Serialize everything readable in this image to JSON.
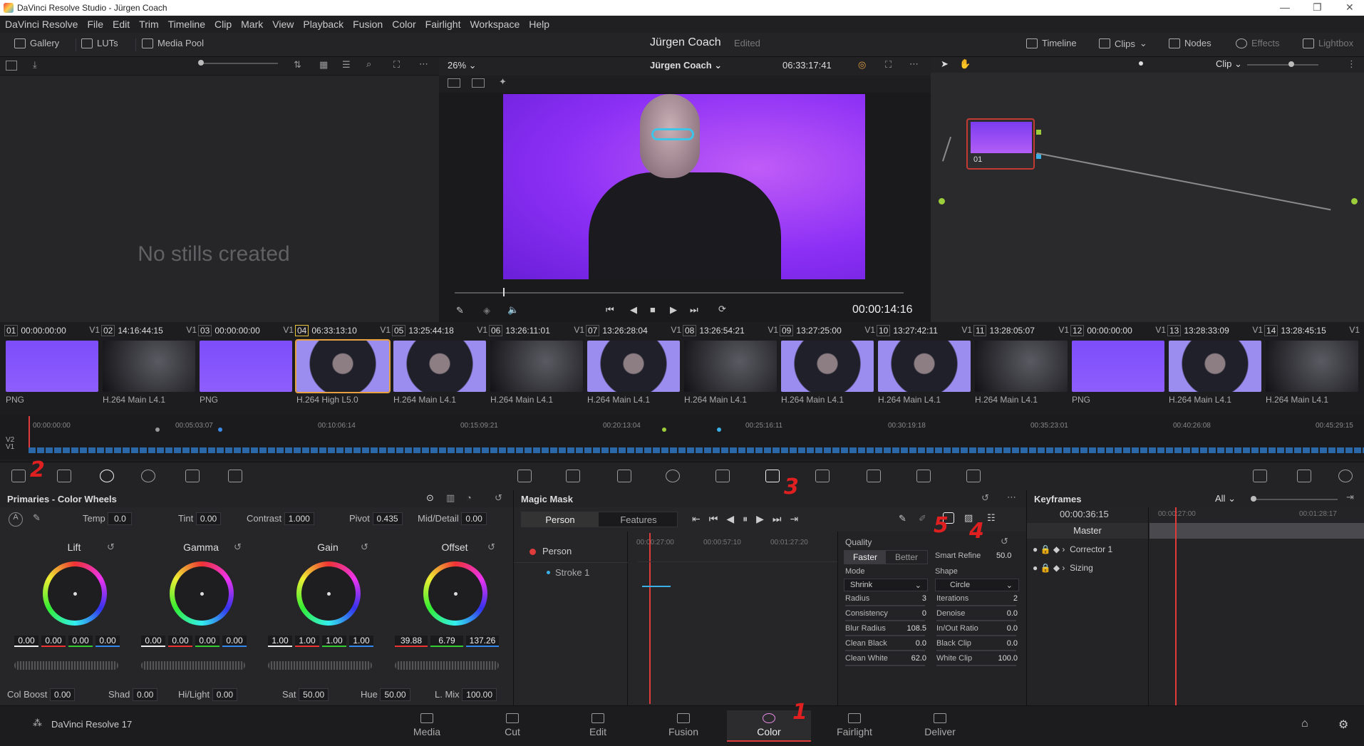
{
  "window": {
    "title": "DaVinci Resolve Studio - Jürgen Coach"
  },
  "menu": [
    "DaVinci Resolve",
    "File",
    "Edit",
    "Trim",
    "Timeline",
    "Clip",
    "Mark",
    "View",
    "Playback",
    "Fusion",
    "Color",
    "Fairlight",
    "Workspace",
    "Help"
  ],
  "toolbar": {
    "gallery": "Gallery",
    "luts": "LUTs",
    "media_pool": "Media Pool",
    "project": "Jürgen Coach",
    "status": "Edited",
    "timeline": "Timeline",
    "clips": "Clips",
    "nodes": "Nodes",
    "effects": "Effects",
    "lightbox": "Lightbox"
  },
  "gallery": {
    "empty": "No stills created"
  },
  "viewer": {
    "zoom": "26%",
    "timeline_name": "Jürgen Coach",
    "timecode_top": "06:33:17:41",
    "timecode": "00:00:14:16"
  },
  "nodes": {
    "mode": "Clip",
    "node_label": "01"
  },
  "clips": [
    {
      "num": "01",
      "tc": "00:00:00:00",
      "track": "V1",
      "codec": "PNG",
      "kind": "png"
    },
    {
      "num": "02",
      "tc": "14:16:44:15",
      "track": "V1",
      "codec": "H.264 Main L4.1",
      "kind": "dark"
    },
    {
      "num": "03",
      "tc": "00:00:00:00",
      "track": "V1",
      "codec": "PNG",
      "kind": "png"
    },
    {
      "num": "04",
      "tc": "06:33:13:10",
      "track": "V1",
      "codec": "H.264 High L5.0",
      "kind": "face"
    },
    {
      "num": "05",
      "tc": "13:25:44:18",
      "track": "V1",
      "codec": "H.264 Main L4.1",
      "kind": "face"
    },
    {
      "num": "06",
      "tc": "13:26:11:01",
      "track": "V1",
      "codec": "H.264 Main L4.1",
      "kind": "dark"
    },
    {
      "num": "07",
      "tc": "13:26:28:04",
      "track": "V1",
      "codec": "H.264 Main L4.1",
      "kind": "face"
    },
    {
      "num": "08",
      "tc": "13:26:54:21",
      "track": "V1",
      "codec": "H.264 Main L4.1",
      "kind": "dark"
    },
    {
      "num": "09",
      "tc": "13:27:25:00",
      "track": "V1",
      "codec": "H.264 Main L4.1",
      "kind": "face"
    },
    {
      "num": "10",
      "tc": "13:27:42:11",
      "track": "V1",
      "codec": "H.264 Main L4.1",
      "kind": "face"
    },
    {
      "num": "11",
      "tc": "13:28:05:07",
      "track": "V1",
      "codec": "H.264 Main L4.1",
      "kind": "dark"
    },
    {
      "num": "12",
      "tc": "00:00:00:00",
      "track": "V1",
      "codec": "PNG",
      "kind": "png"
    },
    {
      "num": "13",
      "tc": "13:28:33:09",
      "track": "V1",
      "codec": "H.264 Main L4.1",
      "kind": "face"
    },
    {
      "num": "14",
      "tc": "13:28:45:15",
      "track": "V1",
      "codec": "H.264 Main L4.1",
      "kind": "dark"
    }
  ],
  "ruler": [
    "00:00:00:00",
    "00:05:03:07",
    "00:10:06:14",
    "00:15:09:21",
    "00:20:13:04",
    "00:25:16:11",
    "00:30:19:18",
    "00:35:23:01",
    "00:40:26:08",
    "00:45:29:15"
  ],
  "tracks": {
    "v2": "V2",
    "v1": "V1"
  },
  "primaries": {
    "title": "Primaries - Color Wheels",
    "temp_label": "Temp",
    "temp": "0.0",
    "tint_label": "Tint",
    "tint": "0.00",
    "contrast_label": "Contrast",
    "contrast": "1.000",
    "pivot_label": "Pivot",
    "pivot": "0.435",
    "md_label": "Mid/Detail",
    "md": "0.00",
    "wheels": [
      {
        "name": "Lift",
        "vals": [
          "0.00",
          "0.00",
          "0.00",
          "0.00"
        ]
      },
      {
        "name": "Gamma",
        "vals": [
          "0.00",
          "0.00",
          "0.00",
          "0.00"
        ]
      },
      {
        "name": "Gain",
        "vals": [
          "1.00",
          "1.00",
          "1.00",
          "1.00"
        ]
      },
      {
        "name": "Offset",
        "vals": [
          "39.88",
          "6.79",
          "137.26"
        ]
      }
    ],
    "colboost_label": "Col Boost",
    "colboost": "0.00",
    "shad_label": "Shad",
    "shad": "0.00",
    "hilight_label": "Hi/Light",
    "hilight": "0.00",
    "sat_label": "Sat",
    "sat": "50.00",
    "hue_label": "Hue",
    "hue": "50.00",
    "lmix_label": "L. Mix",
    "lmix": "100.00"
  },
  "magic": {
    "title": "Magic Mask",
    "tab_person": "Person",
    "tab_features": "Features",
    "track_person": "Person",
    "track_stroke": "Stroke 1",
    "ruler": [
      "00:00:27:00",
      "00:00:57:10",
      "00:01:27:20"
    ],
    "quality_label": "Quality",
    "faster": "Faster",
    "better": "Better",
    "smart_refine_label": "Smart Refine",
    "smart_refine": "50.0",
    "mode_label": "Mode",
    "mode": "Shrink",
    "shape_label": "Shape",
    "shape": "Circle",
    "radius_label": "Radius",
    "radius": "3",
    "iterations_label": "Iterations",
    "iterations": "2",
    "consistency_label": "Consistency",
    "consistency": "0",
    "denoise_label": "Denoise",
    "denoise": "0.0",
    "blur_label": "Blur Radius",
    "blur": "108.5",
    "inout_label": "In/Out Ratio",
    "inout": "0.0",
    "cleanblack_label": "Clean Black",
    "cleanblack": "0.0",
    "blackclip_label": "Black Clip",
    "blackclip": "0.0",
    "cleanwhite_label": "Clean White",
    "cleanwhite": "62.0",
    "whiteclip_label": "White Clip",
    "whiteclip": "100.0"
  },
  "keyframes": {
    "title": "Keyframes",
    "filter": "All",
    "timecode": "00:00:36:15",
    "t1": "00:00:27:00",
    "t2": "00:01:28:17",
    "master": "Master",
    "row1": "Corrector 1",
    "row2": "Sizing"
  },
  "pages": {
    "app": "DaVinci Resolve 17",
    "media": "Media",
    "cut": "Cut",
    "edit": "Edit",
    "fusion": "Fusion",
    "color": "Color",
    "fairlight": "Fairlight",
    "deliver": "Deliver"
  },
  "annotations": [
    "1",
    "2",
    "3",
    "4",
    "5"
  ],
  "colors": {
    "accent": "#e03b3b",
    "mask": "#3ec4e6",
    "timeline": "#2b68a8"
  }
}
